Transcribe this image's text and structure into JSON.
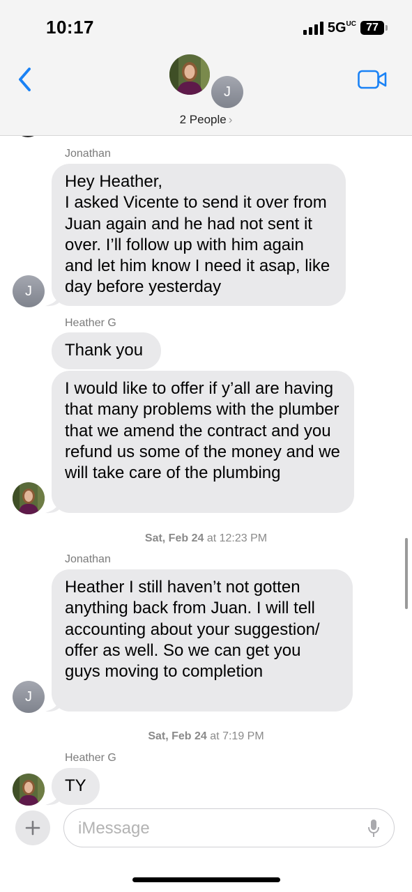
{
  "status_bar": {
    "time": "10:17",
    "network": "5G",
    "network_sup": "UC",
    "battery": "77"
  },
  "header": {
    "people_label": "2 People",
    "chevron": "›",
    "group_initial": "J"
  },
  "messages": [
    {
      "sender": "Jonathan",
      "text": "Hey Heather,\nI asked Vicente to send it over from Juan again and he had not sent it over. I’ll follow up with him again and let him know I need it asap, like day before yesterday",
      "avatar_initial": "J"
    },
    {
      "sender": "Heather G",
      "text": "Thank you"
    },
    {
      "text": "I would like to offer if y’all are having that many problems with the plumber that we amend the contract and you refund us some of the money and we will take care of the plumbing"
    },
    {
      "timestamp_day": "Sat, Feb 24",
      "timestamp_time": "at 12:23 PM"
    },
    {
      "sender": "Jonathan",
      "text": "Heather I still haven’t not gotten anything back from Juan. I will tell accounting about your suggestion/ offer as well. So we can get you guys moving to completion",
      "avatar_initial": "J"
    },
    {
      "timestamp_day": "Sat, Feb 24",
      "timestamp_time": "at 7:19 PM"
    },
    {
      "sender": "Heather G",
      "text": "TY"
    }
  ],
  "composer": {
    "placeholder": "iMessage"
  },
  "colors": {
    "accent": "#1a82f5",
    "bubble_gray": "#e9e9eb",
    "header_bg": "#f4f4f4"
  }
}
